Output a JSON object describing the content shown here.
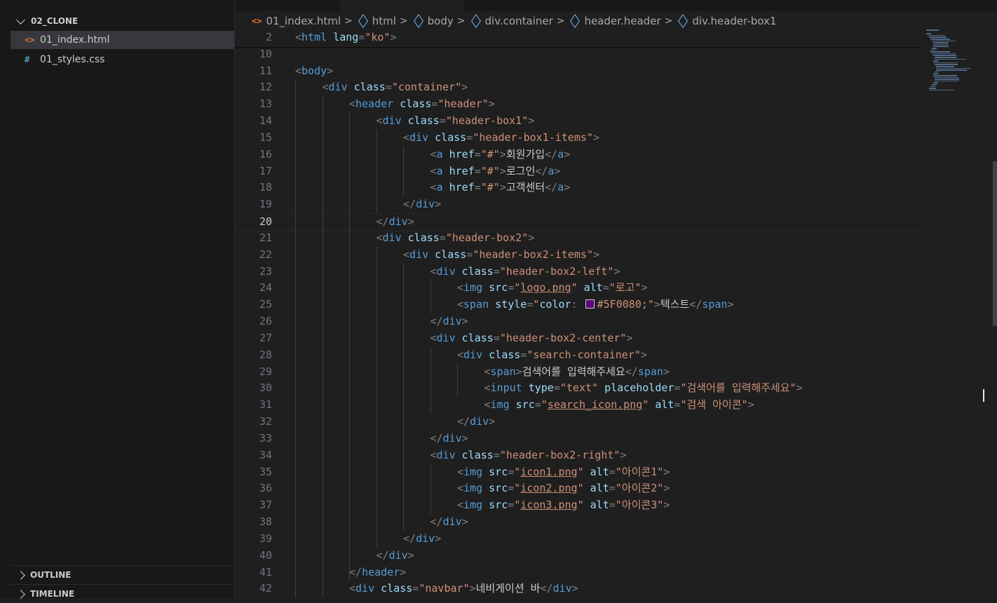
{
  "explorer": {
    "folder_name": "02_CLONE",
    "files": [
      {
        "name": "01_index.html",
        "icon": "html-file-icon",
        "glyph": "<>",
        "active": true
      },
      {
        "name": "01_styles.css",
        "icon": "css-file-icon",
        "glyph": "#",
        "active": false
      }
    ],
    "outline_label": "OUTLINE",
    "timeline_label": "TIMELINE"
  },
  "breadcrumb": {
    "file": "01_index.html",
    "file_glyph": "<>",
    "items": [
      "html",
      "body",
      "div.container",
      "header.header",
      "div.header-box1"
    ],
    "separator": ">"
  },
  "editor": {
    "current_line": "20",
    "color_swatch": "#5F0080",
    "lines": [
      {
        "n": "2",
        "i": 0,
        "t": [
          [
            "p",
            "<"
          ],
          [
            "g",
            "html"
          ],
          [
            "p",
            " "
          ],
          [
            "a",
            "lang"
          ],
          [
            "p",
            "="
          ],
          [
            "s",
            "\"ko\""
          ],
          [
            "p",
            ">"
          ]
        ]
      },
      {
        "n": "10",
        "i": 0,
        "t": []
      },
      {
        "n": "11",
        "i": 0,
        "t": [
          [
            "p",
            "<"
          ],
          [
            "g",
            "body"
          ],
          [
            "p",
            ">"
          ]
        ]
      },
      {
        "n": "12",
        "i": 1,
        "t": [
          [
            "p",
            "<"
          ],
          [
            "g",
            "div"
          ],
          [
            "p",
            " "
          ],
          [
            "a",
            "class"
          ],
          [
            "p",
            "="
          ],
          [
            "s",
            "\"container\""
          ],
          [
            "p",
            ">"
          ]
        ]
      },
      {
        "n": "13",
        "i": 2,
        "t": [
          [
            "p",
            "<"
          ],
          [
            "g",
            "header"
          ],
          [
            "p",
            " "
          ],
          [
            "a",
            "class"
          ],
          [
            "p",
            "="
          ],
          [
            "s",
            "\"header\""
          ],
          [
            "p",
            ">"
          ]
        ]
      },
      {
        "n": "14",
        "i": 3,
        "t": [
          [
            "p",
            "<"
          ],
          [
            "g",
            "div"
          ],
          [
            "p",
            " "
          ],
          [
            "a",
            "class"
          ],
          [
            "p",
            "="
          ],
          [
            "s",
            "\"header-box1\""
          ],
          [
            "p",
            ">"
          ]
        ]
      },
      {
        "n": "15",
        "i": 4,
        "t": [
          [
            "p",
            "<"
          ],
          [
            "g",
            "div"
          ],
          [
            "p",
            " "
          ],
          [
            "a",
            "class"
          ],
          [
            "p",
            "="
          ],
          [
            "s",
            "\"header-box1-items\""
          ],
          [
            "p",
            ">"
          ]
        ]
      },
      {
        "n": "16",
        "i": 5,
        "t": [
          [
            "p",
            "<"
          ],
          [
            "g",
            "a"
          ],
          [
            "p",
            " "
          ],
          [
            "a",
            "href"
          ],
          [
            "p",
            "="
          ],
          [
            "s",
            "\"#\""
          ],
          [
            "p",
            ">"
          ],
          [
            "x",
            "회원가입"
          ],
          [
            "p",
            "</"
          ],
          [
            "g",
            "a"
          ],
          [
            "p",
            ">"
          ]
        ]
      },
      {
        "n": "17",
        "i": 5,
        "t": [
          [
            "p",
            "<"
          ],
          [
            "g",
            "a"
          ],
          [
            "p",
            " "
          ],
          [
            "a",
            "href"
          ],
          [
            "p",
            "="
          ],
          [
            "s",
            "\"#\""
          ],
          [
            "p",
            ">"
          ],
          [
            "x",
            "로그인"
          ],
          [
            "p",
            "</"
          ],
          [
            "g",
            "a"
          ],
          [
            "p",
            ">"
          ]
        ]
      },
      {
        "n": "18",
        "i": 5,
        "t": [
          [
            "p",
            "<"
          ],
          [
            "g",
            "a"
          ],
          [
            "p",
            " "
          ],
          [
            "a",
            "href"
          ],
          [
            "p",
            "="
          ],
          [
            "s",
            "\"#\""
          ],
          [
            "p",
            ">"
          ],
          [
            "x",
            "고객센터"
          ],
          [
            "p",
            "</"
          ],
          [
            "g",
            "a"
          ],
          [
            "p",
            ">"
          ]
        ]
      },
      {
        "n": "19",
        "i": 4,
        "t": [
          [
            "p",
            "</"
          ],
          [
            "g",
            "div"
          ],
          [
            "p",
            ">"
          ]
        ]
      },
      {
        "n": "20",
        "i": 3,
        "t": [
          [
            "p",
            "</"
          ],
          [
            "g",
            "div"
          ],
          [
            "p",
            ">"
          ]
        ]
      },
      {
        "n": "21",
        "i": 3,
        "t": [
          [
            "p",
            "<"
          ],
          [
            "g",
            "div"
          ],
          [
            "p",
            " "
          ],
          [
            "a",
            "class"
          ],
          [
            "p",
            "="
          ],
          [
            "s",
            "\"header-box2\""
          ],
          [
            "p",
            ">"
          ]
        ]
      },
      {
        "n": "22",
        "i": 4,
        "t": [
          [
            "p",
            "<"
          ],
          [
            "g",
            "div"
          ],
          [
            "p",
            " "
          ],
          [
            "a",
            "class"
          ],
          [
            "p",
            "="
          ],
          [
            "s",
            "\"header-box2-items\""
          ],
          [
            "p",
            ">"
          ]
        ]
      },
      {
        "n": "23",
        "i": 5,
        "t": [
          [
            "p",
            "<"
          ],
          [
            "g",
            "div"
          ],
          [
            "p",
            " "
          ],
          [
            "a",
            "class"
          ],
          [
            "p",
            "="
          ],
          [
            "s",
            "\"header-box2-left\""
          ],
          [
            "p",
            ">"
          ]
        ]
      },
      {
        "n": "24",
        "i": 6,
        "t": [
          [
            "p",
            "<"
          ],
          [
            "g",
            "img"
          ],
          [
            "p",
            " "
          ],
          [
            "a",
            "src"
          ],
          [
            "p",
            "="
          ],
          [
            "s",
            "\""
          ],
          [
            "u",
            "logo.png"
          ],
          [
            "s",
            "\""
          ],
          [
            "p",
            " "
          ],
          [
            "a",
            "alt"
          ],
          [
            "p",
            "="
          ],
          [
            "s",
            "\"로고\""
          ],
          [
            "p",
            ">"
          ]
        ]
      },
      {
        "n": "25",
        "i": 6,
        "t": [
          [
            "p",
            "<"
          ],
          [
            "g",
            "span"
          ],
          [
            "p",
            " "
          ],
          [
            "a",
            "style"
          ],
          [
            "p",
            "="
          ],
          [
            "s",
            "\""
          ],
          [
            "a",
            "color"
          ],
          [
            "p",
            ": "
          ],
          [
            "c",
            ""
          ],
          [
            "s",
            "#5F0080;\""
          ],
          [
            "p",
            ">"
          ],
          [
            "x",
            "텍스트"
          ],
          [
            "p",
            "</"
          ],
          [
            "g",
            "span"
          ],
          [
            "p",
            ">"
          ]
        ]
      },
      {
        "n": "26",
        "i": 5,
        "t": [
          [
            "p",
            "</"
          ],
          [
            "g",
            "div"
          ],
          [
            "p",
            ">"
          ]
        ]
      },
      {
        "n": "27",
        "i": 5,
        "t": [
          [
            "p",
            "<"
          ],
          [
            "g",
            "div"
          ],
          [
            "p",
            " "
          ],
          [
            "a",
            "class"
          ],
          [
            "p",
            "="
          ],
          [
            "s",
            "\"header-box2-center\""
          ],
          [
            "p",
            ">"
          ]
        ]
      },
      {
        "n": "28",
        "i": 6,
        "t": [
          [
            "p",
            "<"
          ],
          [
            "g",
            "div"
          ],
          [
            "p",
            " "
          ],
          [
            "a",
            "class"
          ],
          [
            "p",
            "="
          ],
          [
            "s",
            "\"search-container\""
          ],
          [
            "p",
            ">"
          ]
        ]
      },
      {
        "n": "29",
        "i": 7,
        "t": [
          [
            "p",
            "<"
          ],
          [
            "g",
            "span"
          ],
          [
            "p",
            ">"
          ],
          [
            "x",
            "검색어를 입력해주세요"
          ],
          [
            "p",
            "</"
          ],
          [
            "g",
            "span"
          ],
          [
            "p",
            ">"
          ]
        ]
      },
      {
        "n": "30",
        "i": 7,
        "t": [
          [
            "p",
            "<"
          ],
          [
            "g",
            "input"
          ],
          [
            "p",
            " "
          ],
          [
            "a",
            "type"
          ],
          [
            "p",
            "="
          ],
          [
            "s",
            "\"text\""
          ],
          [
            "p",
            " "
          ],
          [
            "a",
            "placeholder"
          ],
          [
            "p",
            "="
          ],
          [
            "s",
            "\"검색어를 입력해주세요\""
          ],
          [
            "p",
            ">"
          ]
        ]
      },
      {
        "n": "31",
        "i": 7,
        "t": [
          [
            "p",
            "<"
          ],
          [
            "g",
            "img"
          ],
          [
            "p",
            " "
          ],
          [
            "a",
            "src"
          ],
          [
            "p",
            "="
          ],
          [
            "s",
            "\""
          ],
          [
            "u",
            "search_icon.png"
          ],
          [
            "s",
            "\""
          ],
          [
            "p",
            " "
          ],
          [
            "a",
            "alt"
          ],
          [
            "p",
            "="
          ],
          [
            "s",
            "\"검색 아이콘\""
          ],
          [
            "p",
            ">"
          ]
        ]
      },
      {
        "n": "32",
        "i": 6,
        "t": [
          [
            "p",
            "</"
          ],
          [
            "g",
            "div"
          ],
          [
            "p",
            ">"
          ]
        ]
      },
      {
        "n": "33",
        "i": 5,
        "t": [
          [
            "p",
            "</"
          ],
          [
            "g",
            "div"
          ],
          [
            "p",
            ">"
          ]
        ]
      },
      {
        "n": "34",
        "i": 5,
        "t": [
          [
            "p",
            "<"
          ],
          [
            "g",
            "div"
          ],
          [
            "p",
            " "
          ],
          [
            "a",
            "class"
          ],
          [
            "p",
            "="
          ],
          [
            "s",
            "\"header-box2-right\""
          ],
          [
            "p",
            ">"
          ]
        ]
      },
      {
        "n": "35",
        "i": 6,
        "t": [
          [
            "p",
            "<"
          ],
          [
            "g",
            "img"
          ],
          [
            "p",
            " "
          ],
          [
            "a",
            "src"
          ],
          [
            "p",
            "="
          ],
          [
            "s",
            "\""
          ],
          [
            "u",
            "icon1.png"
          ],
          [
            "s",
            "\""
          ],
          [
            "p",
            " "
          ],
          [
            "a",
            "alt"
          ],
          [
            "p",
            "="
          ],
          [
            "s",
            "\"아이콘1\""
          ],
          [
            "p",
            ">"
          ]
        ]
      },
      {
        "n": "36",
        "i": 6,
        "t": [
          [
            "p",
            "<"
          ],
          [
            "g",
            "img"
          ],
          [
            "p",
            " "
          ],
          [
            "a",
            "src"
          ],
          [
            "p",
            "="
          ],
          [
            "s",
            "\""
          ],
          [
            "u",
            "icon2.png"
          ],
          [
            "s",
            "\""
          ],
          [
            "p",
            " "
          ],
          [
            "a",
            "alt"
          ],
          [
            "p",
            "="
          ],
          [
            "s",
            "\"아이콘2\""
          ],
          [
            "p",
            ">"
          ]
        ]
      },
      {
        "n": "37",
        "i": 6,
        "t": [
          [
            "p",
            "<"
          ],
          [
            "g",
            "img"
          ],
          [
            "p",
            " "
          ],
          [
            "a",
            "src"
          ],
          [
            "p",
            "="
          ],
          [
            "s",
            "\""
          ],
          [
            "u",
            "icon3.png"
          ],
          [
            "s",
            "\""
          ],
          [
            "p",
            " "
          ],
          [
            "a",
            "alt"
          ],
          [
            "p",
            "="
          ],
          [
            "s",
            "\"아이콘3\""
          ],
          [
            "p",
            ">"
          ]
        ]
      },
      {
        "n": "38",
        "i": 5,
        "t": [
          [
            "p",
            "</"
          ],
          [
            "g",
            "div"
          ],
          [
            "p",
            ">"
          ]
        ]
      },
      {
        "n": "39",
        "i": 4,
        "t": [
          [
            "p",
            "</"
          ],
          [
            "g",
            "div"
          ],
          [
            "p",
            ">"
          ]
        ]
      },
      {
        "n": "40",
        "i": 3,
        "t": [
          [
            "p",
            "</"
          ],
          [
            "g",
            "div"
          ],
          [
            "p",
            ">"
          ]
        ]
      },
      {
        "n": "41",
        "i": 2,
        "t": [
          [
            "p",
            "</"
          ],
          [
            "g",
            "header"
          ],
          [
            "p",
            ">"
          ]
        ]
      },
      {
        "n": "42",
        "i": 2,
        "t": [
          [
            "p",
            "<"
          ],
          [
            "g",
            "div"
          ],
          [
            "p",
            " "
          ],
          [
            "a",
            "class"
          ],
          [
            "p",
            "="
          ],
          [
            "s",
            "\"navbar\""
          ],
          [
            "p",
            ">"
          ],
          [
            "x",
            "네비게이션 바"
          ],
          [
            "p",
            "</"
          ],
          [
            "g",
            "div"
          ],
          [
            "p",
            ">"
          ]
        ]
      }
    ]
  }
}
